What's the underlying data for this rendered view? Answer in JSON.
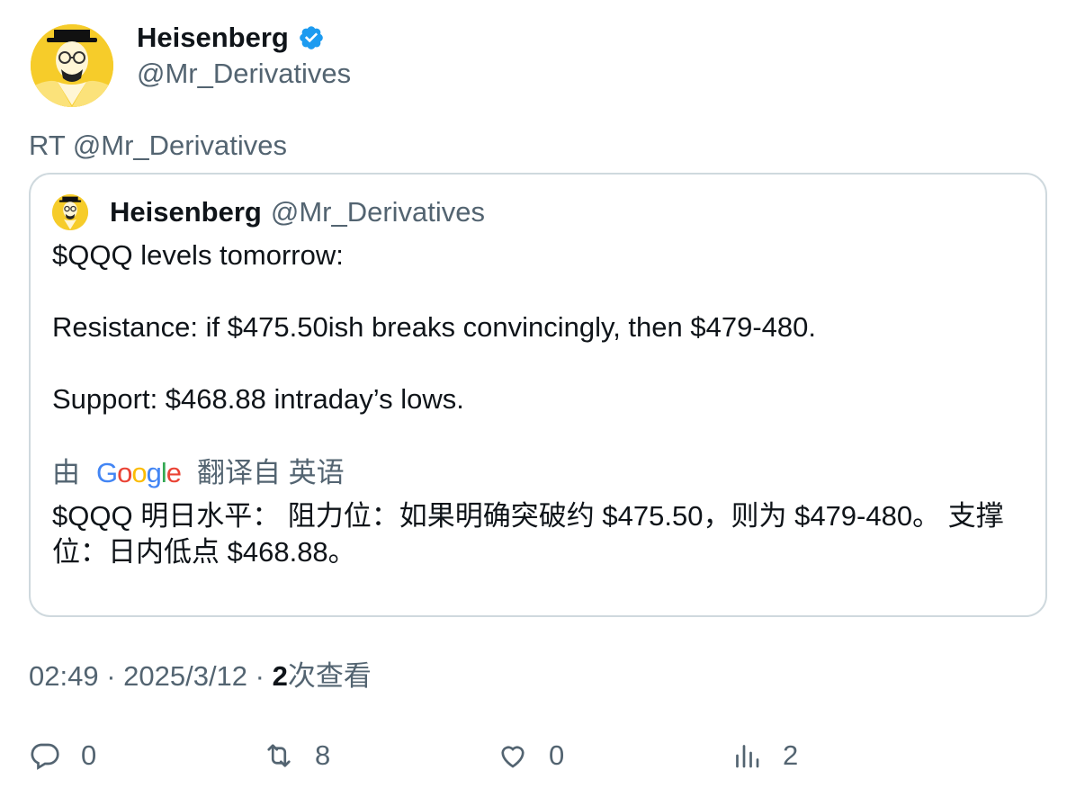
{
  "author": {
    "name": "Heisenberg",
    "handle": "@Mr_Derivatives"
  },
  "retweet_label": "RT @Mr_Derivatives",
  "quote": {
    "name": "Heisenberg",
    "handle": "@Mr_Derivatives",
    "lines": [
      "$QQQ levels tomorrow:",
      "Resistance: if $475.50ish breaks convincingly, then $479-480.",
      "Support: $468.88 intraday’s lows."
    ],
    "translation": {
      "prefix": "由",
      "provider": "Google",
      "suffix": "翻译自 英语",
      "text": "$QQQ 明日水平： 阻力位：如果明确突破约 $475.50，则为 $479-480。 支撑位：日内低点 $468.88。"
    }
  },
  "meta": {
    "time_date": "02:49 · 2025/3/12 · ",
    "views_count": "2",
    "views_label": "次查看"
  },
  "actions": {
    "replies": "0",
    "retweets": "8",
    "likes": "0",
    "views": "2"
  },
  "colors": {
    "verified": "#1d9bf0",
    "secondary_text": "#536471",
    "border": "#cfd9de",
    "avatar_bg": "#f6cc2a"
  }
}
